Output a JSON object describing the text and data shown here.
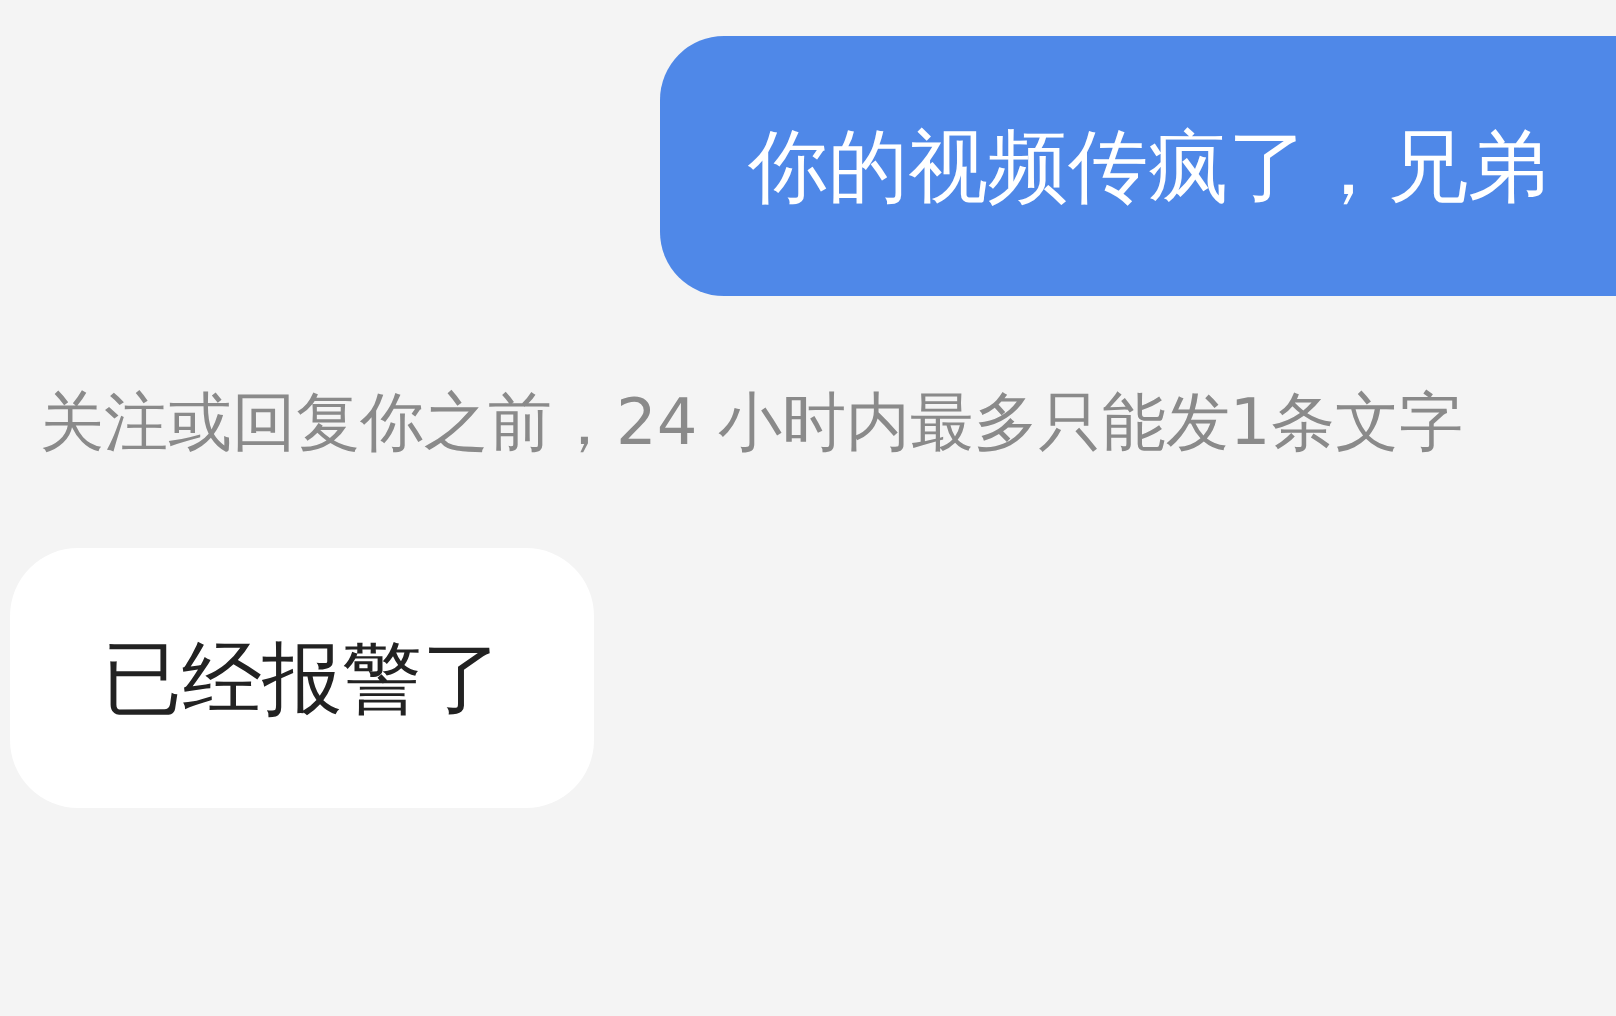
{
  "messages": [
    {
      "kind": "outgoing",
      "text": "你的视频传疯了，兄弟"
    },
    {
      "kind": "notice",
      "text": "关注或回复你之前，24 小时内最多只能发1条文字"
    },
    {
      "kind": "incoming",
      "text": "已经报警了"
    }
  ]
}
